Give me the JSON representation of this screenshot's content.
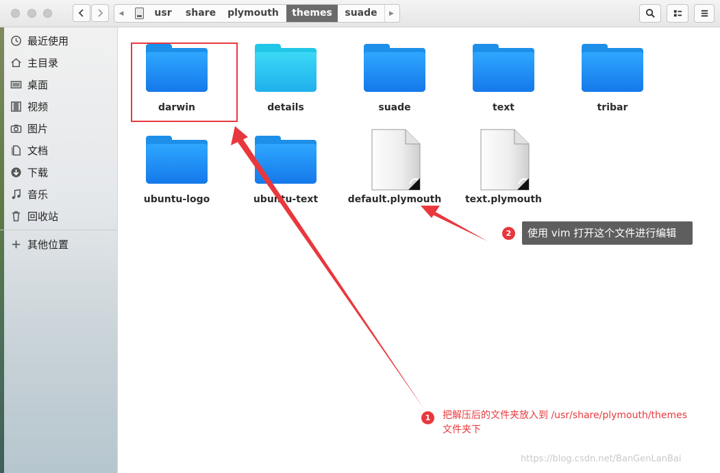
{
  "window": {
    "path": [
      {
        "label": "usr",
        "active": false
      },
      {
        "label": "share",
        "active": false
      },
      {
        "label": "plymouth",
        "active": false
      },
      {
        "label": "themes",
        "active": true
      },
      {
        "label": "suade",
        "active": false
      }
    ]
  },
  "toolbar": {
    "search_icon": "search-icon",
    "view_icon": "list-view-icon",
    "menu_icon": "hamburger-menu-icon"
  },
  "sidebar": {
    "items": [
      {
        "label": "最近使用",
        "icon": "clock-icon"
      },
      {
        "label": "主目录",
        "icon": "home-icon"
      },
      {
        "label": "桌面",
        "icon": "desktop-icon"
      },
      {
        "label": "视频",
        "icon": "film-icon"
      },
      {
        "label": "图片",
        "icon": "camera-icon"
      },
      {
        "label": "文档",
        "icon": "document-icon"
      },
      {
        "label": "下载",
        "icon": "download-icon"
      },
      {
        "label": "音乐",
        "icon": "music-icon"
      },
      {
        "label": "回收站",
        "icon": "trash-icon"
      }
    ],
    "other": {
      "label": "其他位置",
      "icon": "plus-icon"
    }
  },
  "files": [
    {
      "name": "darwin",
      "type": "folder",
      "color": "#1d8fe8"
    },
    {
      "name": "details",
      "type": "folder",
      "color": "#22c6e6"
    },
    {
      "name": "suade",
      "type": "folder",
      "color": "#1d8fe8"
    },
    {
      "name": "text",
      "type": "folder",
      "color": "#1d8fe8"
    },
    {
      "name": "tribar",
      "type": "folder",
      "color": "#1d8fe8"
    },
    {
      "name": "ubuntu-logo",
      "type": "folder",
      "color": "#1d8fe8"
    },
    {
      "name": "ubuntu-text",
      "type": "folder",
      "color": "#1d8fe8"
    },
    {
      "name": "default.plymouth",
      "type": "file"
    },
    {
      "name": "text.plymouth",
      "type": "file"
    }
  ],
  "annotations": {
    "step1": {
      "num": "1",
      "text_line1": "把解压后的文件夹放入到 /usr/share/plymouth/themes",
      "text_line2": "文件夹下"
    },
    "step2": {
      "num": "2",
      "text": "使用 vim 打开这个文件进行编辑"
    },
    "accent_color": "#e8383d"
  },
  "watermark": "https://blog.csdn.net/BanGenLanBai"
}
